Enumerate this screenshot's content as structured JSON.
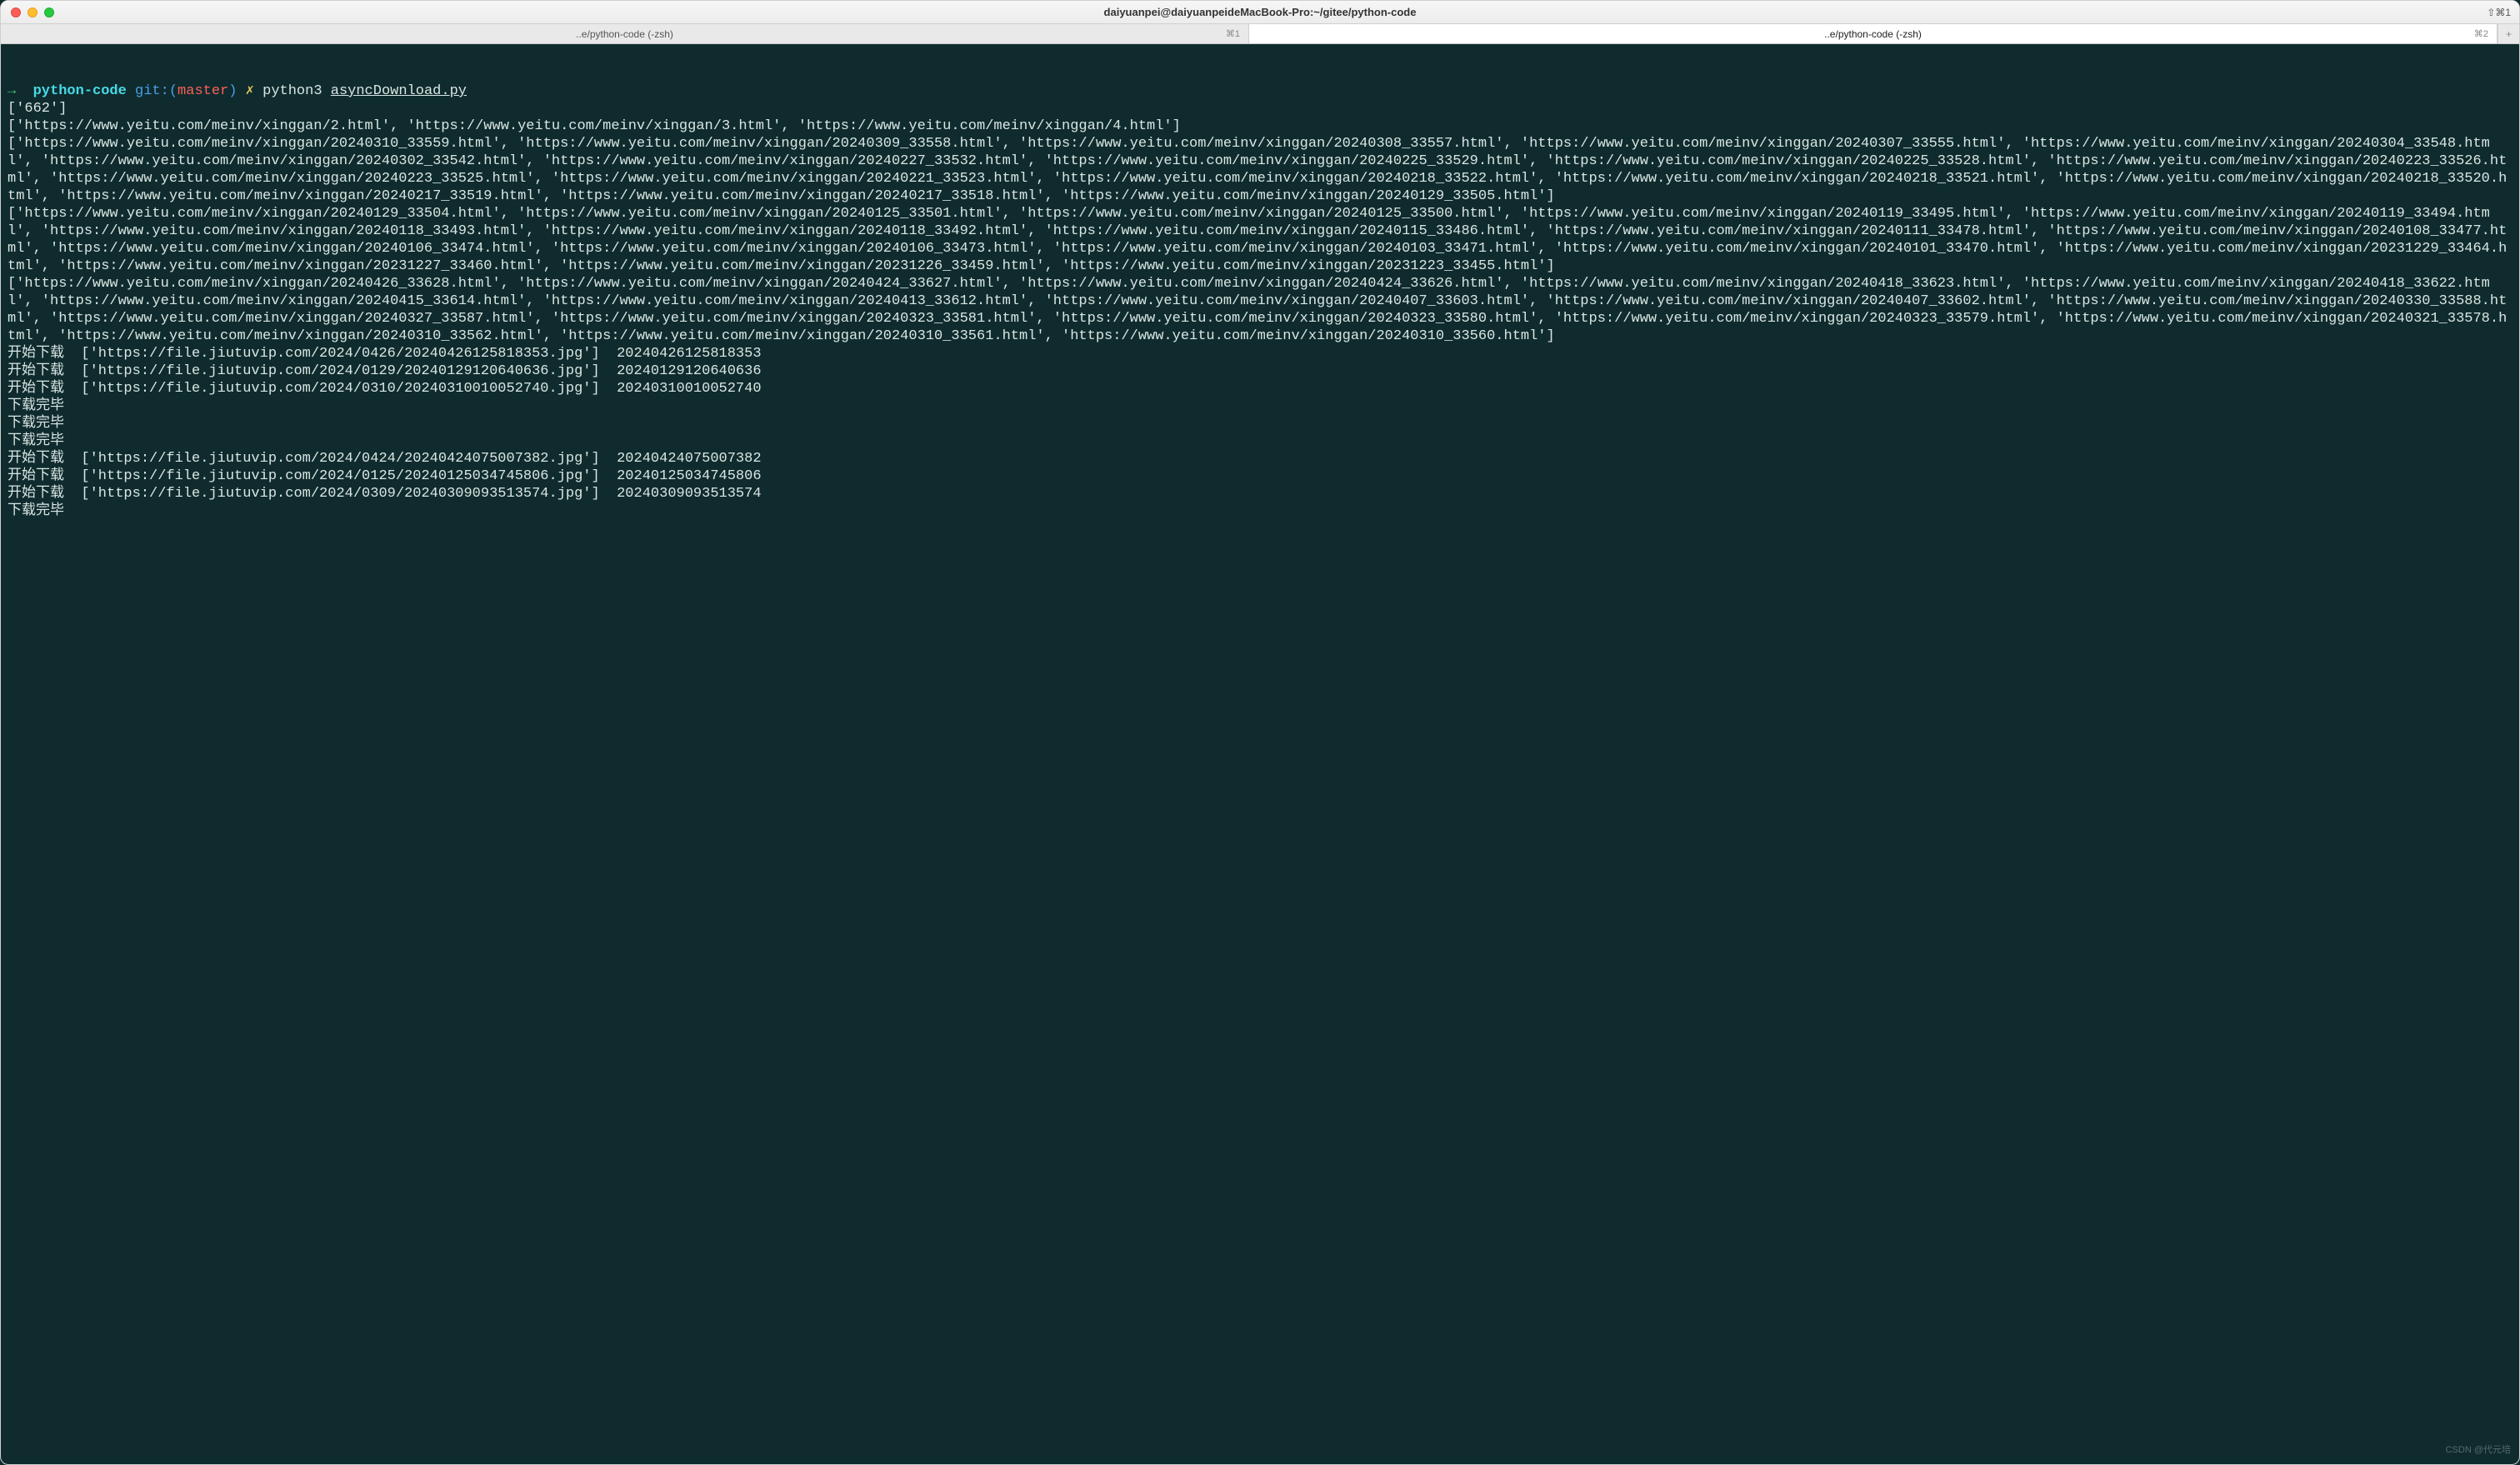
{
  "window": {
    "title": "daiyuanpei@daiyuanpeideMacBook-Pro:~/gitee/python-code",
    "shortcut_hint": "⇧⌘1"
  },
  "tabs": [
    {
      "label": "..e/python-code (-zsh)",
      "shortcut": "⌘1",
      "active": false
    },
    {
      "label": "..e/python-code (-zsh)",
      "shortcut": "⌘2",
      "active": true
    }
  ],
  "prompt": {
    "arrow": "→",
    "folder": "python-code",
    "git_label": "git:",
    "branch": "master",
    "x": "✗",
    "command_runner": "python3",
    "command_script": "asyncDownload.py"
  },
  "output": {
    "blocks": [
      "['662']",
      "['https://www.yeitu.com/meinv/xinggan/2.html', 'https://www.yeitu.com/meinv/xinggan/3.html', 'https://www.yeitu.com/meinv/xinggan/4.html']",
      "['https://www.yeitu.com/meinv/xinggan/20240310_33559.html', 'https://www.yeitu.com/meinv/xinggan/20240309_33558.html', 'https://www.yeitu.com/meinv/xinggan/20240308_33557.html', 'https://www.yeitu.com/meinv/xinggan/20240307_33555.html', 'https://www.yeitu.com/meinv/xinggan/20240304_33548.html', 'https://www.yeitu.com/meinv/xinggan/20240302_33542.html', 'https://www.yeitu.com/meinv/xinggan/20240227_33532.html', 'https://www.yeitu.com/meinv/xinggan/20240225_33529.html', 'https://www.yeitu.com/meinv/xinggan/20240225_33528.html', 'https://www.yeitu.com/meinv/xinggan/20240223_33526.html', 'https://www.yeitu.com/meinv/xinggan/20240223_33525.html', 'https://www.yeitu.com/meinv/xinggan/20240221_33523.html', 'https://www.yeitu.com/meinv/xinggan/20240218_33522.html', 'https://www.yeitu.com/meinv/xinggan/20240218_33521.html', 'https://www.yeitu.com/meinv/xinggan/20240218_33520.html', 'https://www.yeitu.com/meinv/xinggan/20240217_33519.html', 'https://www.yeitu.com/meinv/xinggan/20240217_33518.html', 'https://www.yeitu.com/meinv/xinggan/20240129_33505.html']",
      "['https://www.yeitu.com/meinv/xinggan/20240129_33504.html', 'https://www.yeitu.com/meinv/xinggan/20240125_33501.html', 'https://www.yeitu.com/meinv/xinggan/20240125_33500.html', 'https://www.yeitu.com/meinv/xinggan/20240119_33495.html', 'https://www.yeitu.com/meinv/xinggan/20240119_33494.html', 'https://www.yeitu.com/meinv/xinggan/20240118_33493.html', 'https://www.yeitu.com/meinv/xinggan/20240118_33492.html', 'https://www.yeitu.com/meinv/xinggan/20240115_33486.html', 'https://www.yeitu.com/meinv/xinggan/20240111_33478.html', 'https://www.yeitu.com/meinv/xinggan/20240108_33477.html', 'https://www.yeitu.com/meinv/xinggan/20240106_33474.html', 'https://www.yeitu.com/meinv/xinggan/20240106_33473.html', 'https://www.yeitu.com/meinv/xinggan/20240103_33471.html', 'https://www.yeitu.com/meinv/xinggan/20240101_33470.html', 'https://www.yeitu.com/meinv/xinggan/20231229_33464.html', 'https://www.yeitu.com/meinv/xinggan/20231227_33460.html', 'https://www.yeitu.com/meinv/xinggan/20231226_33459.html', 'https://www.yeitu.com/meinv/xinggan/20231223_33455.html']",
      "['https://www.yeitu.com/meinv/xinggan/20240426_33628.html', 'https://www.yeitu.com/meinv/xinggan/20240424_33627.html', 'https://www.yeitu.com/meinv/xinggan/20240424_33626.html', 'https://www.yeitu.com/meinv/xinggan/20240418_33623.html', 'https://www.yeitu.com/meinv/xinggan/20240418_33622.html', 'https://www.yeitu.com/meinv/xinggan/20240415_33614.html', 'https://www.yeitu.com/meinv/xinggan/20240413_33612.html', 'https://www.yeitu.com/meinv/xinggan/20240407_33603.html', 'https://www.yeitu.com/meinv/xinggan/20240407_33602.html', 'https://www.yeitu.com/meinv/xinggan/20240330_33588.html', 'https://www.yeitu.com/meinv/xinggan/20240327_33587.html', 'https://www.yeitu.com/meinv/xinggan/20240323_33581.html', 'https://www.yeitu.com/meinv/xinggan/20240323_33580.html', 'https://www.yeitu.com/meinv/xinggan/20240323_33579.html', 'https://www.yeitu.com/meinv/xinggan/20240321_33578.html', 'https://www.yeitu.com/meinv/xinggan/20240310_33562.html', 'https://www.yeitu.com/meinv/xinggan/20240310_33561.html', 'https://www.yeitu.com/meinv/xinggan/20240310_33560.html']",
      "开始下载  ['https://file.jiutuvip.com/2024/0426/20240426125818353.jpg']  20240426125818353",
      "开始下载  ['https://file.jiutuvip.com/2024/0129/20240129120640636.jpg']  20240129120640636",
      "开始下载  ['https://file.jiutuvip.com/2024/0310/20240310010052740.jpg']  20240310010052740",
      "下载完毕",
      "下载完毕",
      "下载完毕",
      "开始下载  ['https://file.jiutuvip.com/2024/0424/20240424075007382.jpg']  20240424075007382",
      "开始下载  ['https://file.jiutuvip.com/2024/0125/20240125034745806.jpg']  20240125034745806",
      "开始下载  ['https://file.jiutuvip.com/2024/0309/20240309093513574.jpg']  20240309093513574",
      "下载完毕"
    ]
  },
  "watermark": "CSDN @代元培"
}
